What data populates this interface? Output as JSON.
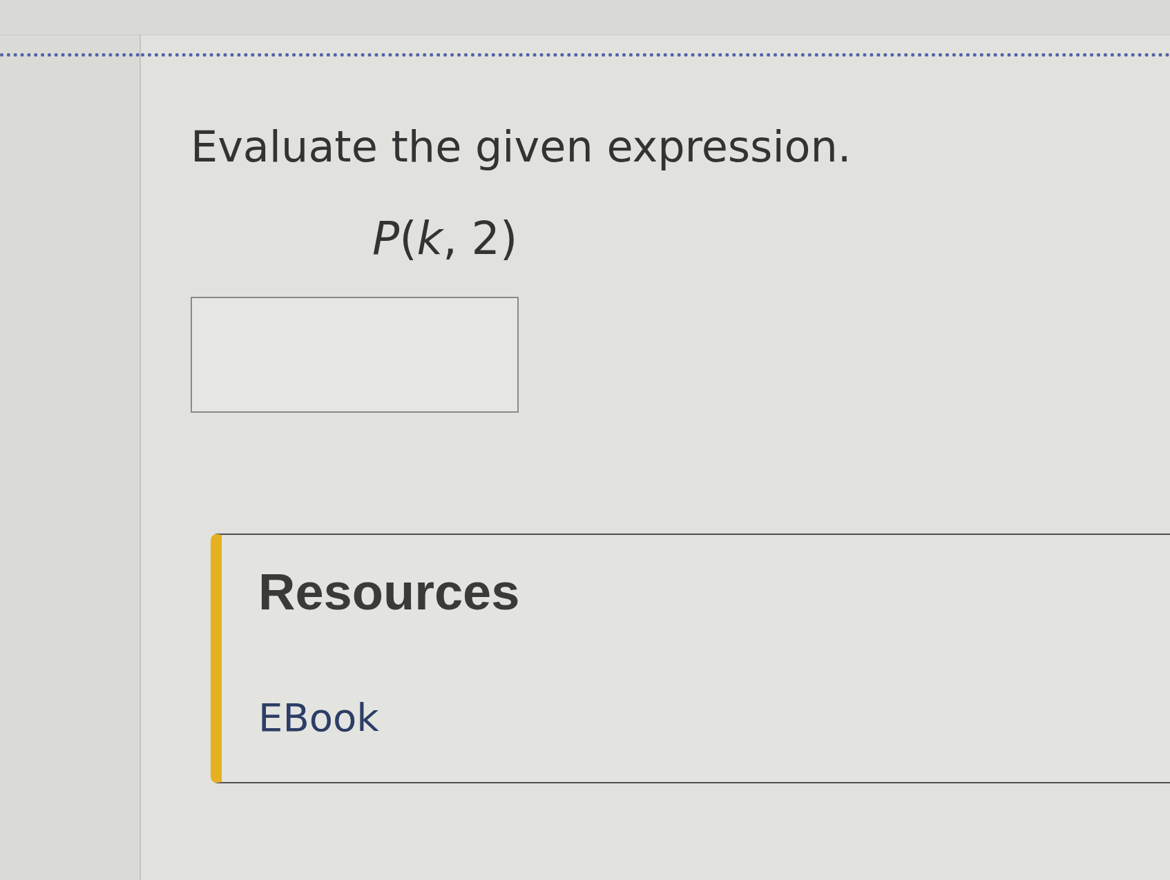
{
  "question": {
    "prompt": "Evaluate the given expression.",
    "expression": "*P*(*k*, 2)"
  },
  "resources": {
    "title": "Resources",
    "links": [
      {
        "label": "EBook"
      }
    ]
  }
}
